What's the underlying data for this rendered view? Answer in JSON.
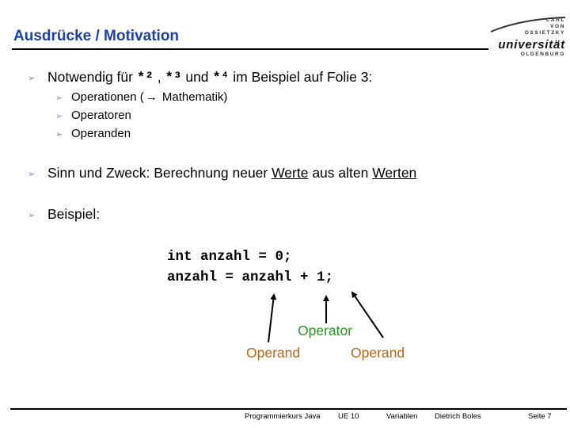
{
  "slide": {
    "title": "Ausdrücke / Motivation",
    "logo": {
      "line1": "CARL",
      "line2": "VON",
      "line3": "OSSIETZKY",
      "line4": "universität",
      "line5": "OLDENBURG"
    },
    "bullets": {
      "b1": {
        "pre": "Notwendig für ",
        "s2": "*²",
        "mid1": " , ",
        "s3": "*³",
        "mid2": " und ",
        "s4": "*⁴",
        "post": " im Beispiel auf Folie 3:"
      },
      "sub": [
        {
          "pre": "Operationen (",
          "arrow": "→",
          "post": " Mathematik)"
        },
        {
          "text": "Operatoren"
        },
        {
          "text": "Operanden"
        }
      ],
      "b2": {
        "pre": "Sinn und Zweck: Berechnung neuer ",
        "w1": "Werte",
        "mid": " aus alten ",
        "w2": "Werten"
      },
      "b3": "Beispiel:"
    },
    "code": {
      "line1": "int anzahl = 0;",
      "line2": "anzahl = anzahl + 1;"
    },
    "annotations": {
      "operator": "Operator",
      "operand_left": "Operand",
      "operand_right": "Operand"
    },
    "footer": {
      "course": "Programmierkurs Java",
      "unit": "UE 10",
      "topic": "Variablen",
      "author": "Dietrich Boles",
      "page": "Seite 7"
    },
    "colors": {
      "title": "#1c3fae",
      "bullet": "#7d8fd6",
      "operator": "#1f9a1f",
      "operand": "#b8651a"
    }
  }
}
